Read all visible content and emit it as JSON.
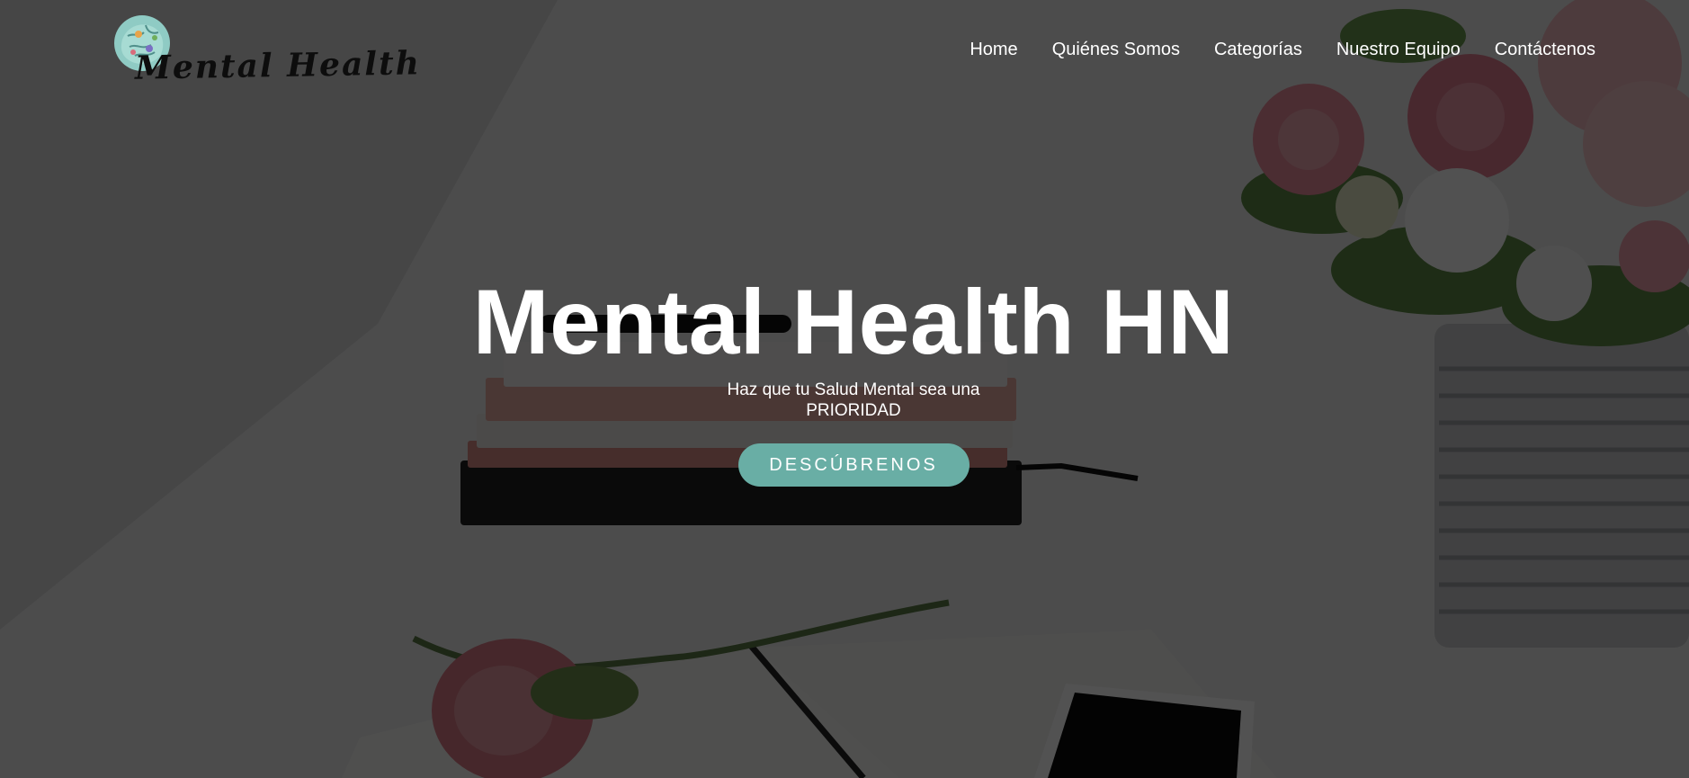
{
  "brand": {
    "logo_text": "Mental Health"
  },
  "nav": {
    "items": [
      {
        "label": "Home"
      },
      {
        "label": "Quiénes Somos"
      },
      {
        "label": "Categorías"
      },
      {
        "label": "Nuestro Equipo"
      },
      {
        "label": "Contáctenos"
      }
    ]
  },
  "hero": {
    "title": "Mental Health HN",
    "subtitle": "Haz que tu Salud Mental sea una PRIORIDAD",
    "cta_label": "DESCÚBRENOS"
  },
  "colors": {
    "accent": "#69aea5",
    "overlay": "#000000"
  }
}
